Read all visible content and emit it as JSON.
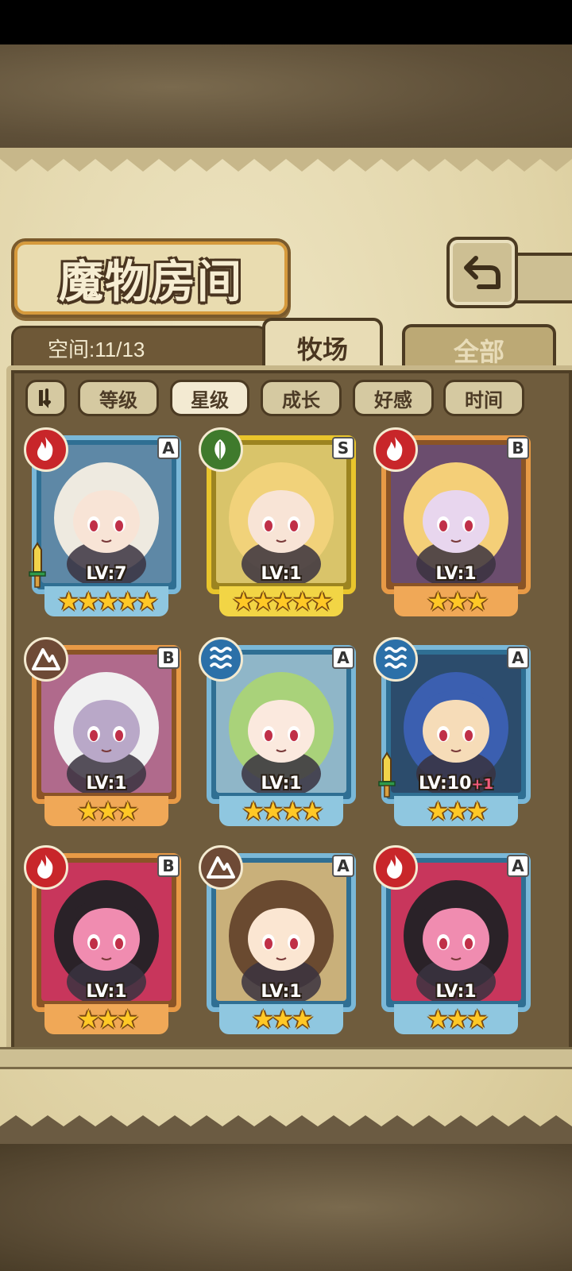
{
  "header": {
    "title": "魔物房间",
    "space_label": "空间:11/13"
  },
  "tabs": [
    {
      "label": "牧场",
      "active": true
    },
    {
      "label": "全部",
      "active": false
    }
  ],
  "sort_buttons": [
    {
      "label": "等级",
      "selected": false
    },
    {
      "label": "星级",
      "selected": true
    },
    {
      "label": "成长",
      "selected": false
    },
    {
      "label": "好感",
      "selected": false
    },
    {
      "label": "时间",
      "selected": false
    }
  ],
  "monsters": [
    {
      "level": "LV:7",
      "level_bonus": "",
      "rank": "A",
      "element": "fire",
      "stars": "★★★★★",
      "frame": "blue",
      "hair": "#eeeae0",
      "skin": "#f8e4d6",
      "bg": "#5e88a6",
      "has_sword": true
    },
    {
      "level": "LV:1",
      "level_bonus": "",
      "rank": "S",
      "element": "leaf",
      "stars": "★★★★★",
      "frame": "gold",
      "hair": "#f1d27a",
      "skin": "#f8e4d6",
      "bg": "#d9c46a",
      "has_sword": false
    },
    {
      "level": "LV:1",
      "level_bonus": "",
      "rank": "B",
      "element": "fire",
      "stars": "★★★",
      "frame": "orange",
      "hair": "#f4cf78",
      "skin": "#e8d6ee",
      "bg": "#6b4d6e",
      "has_sword": false
    },
    {
      "level": "LV:1",
      "level_bonus": "",
      "rank": "B",
      "element": "earth",
      "stars": "★★★",
      "frame": "orange",
      "hair": "#f1f1f1",
      "skin": "#b9a8c8",
      "bg": "#b06a8c",
      "has_sword": false
    },
    {
      "level": "LV:1",
      "level_bonus": "",
      "rank": "A",
      "element": "water",
      "stars": "★★★★",
      "frame": "blue",
      "hair": "#a9d27a",
      "skin": "#fbe9de",
      "bg": "#8fb6c8",
      "has_sword": false
    },
    {
      "level": "LV:10",
      "level_bonus": "+1",
      "rank": "A",
      "element": "water",
      "stars": "★★★",
      "frame": "blue",
      "hair": "#3b5fb0",
      "skin": "#f6dcb8",
      "bg": "#2c4c6c",
      "has_sword": true
    },
    {
      "level": "LV:1",
      "level_bonus": "",
      "rank": "B",
      "element": "fire",
      "stars": "★★★",
      "frame": "orange",
      "hair": "#2a2228",
      "skin": "#f08cb0",
      "bg": "#c8365c",
      "has_sword": false
    },
    {
      "level": "LV:1",
      "level_bonus": "",
      "rank": "A",
      "element": "earth",
      "stars": "★★★",
      "frame": "blue",
      "hair": "#6a4a30",
      "skin": "#fbe6d2",
      "bg": "#c9b07a",
      "has_sword": false
    },
    {
      "level": "LV:1",
      "level_bonus": "",
      "rank": "A",
      "element": "fire",
      "stars": "★★★",
      "frame": "blue",
      "hair": "#2a2228",
      "skin": "#f08cb0",
      "bg": "#c8365c",
      "has_sword": false
    }
  ],
  "colors": {
    "fire": "#c8262a",
    "leaf": "#3f7a2c",
    "earth": "#6e4a36",
    "water": "#2c70a8"
  }
}
